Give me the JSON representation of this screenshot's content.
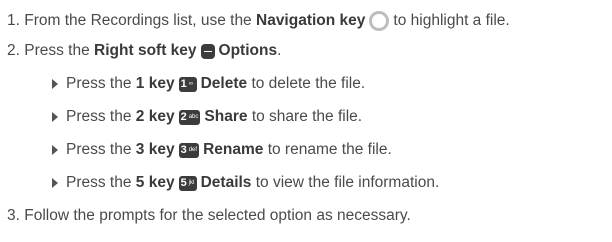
{
  "steps": [
    {
      "number": "1.",
      "text_a": "From the Recordings list, use the",
      "key": "Navigation key",
      "icon": "navigation-key-icon",
      "text_b": "to highlight a file."
    },
    {
      "number": "2.",
      "text_a": "Press the",
      "key": "Right soft key",
      "icon": "right-soft-key-icon",
      "option": "Options",
      "text_b": "."
    },
    {
      "number": "3.",
      "text_a": "Follow the prompts for the selected option as necessary."
    }
  ],
  "options": [
    {
      "text_a": "Press the",
      "key": "1 key",
      "key_glyph": "1",
      "key_small": "∞",
      "action": "Delete",
      "text_b": "to delete the file."
    },
    {
      "text_a": "Press the",
      "key": "2 key",
      "key_glyph": "2",
      "key_small": "abc",
      "action": "Share",
      "text_b": "to share the file."
    },
    {
      "text_a": "Press the",
      "key": "3 key",
      "key_glyph": "3",
      "key_small": "def",
      "action": "Rename",
      "text_b": "to rename the file."
    },
    {
      "text_a": "Press the",
      "key": "5 key",
      "key_glyph": "5",
      "key_small": "jkl",
      "action": "Details",
      "text_b": "to view the file information."
    }
  ]
}
